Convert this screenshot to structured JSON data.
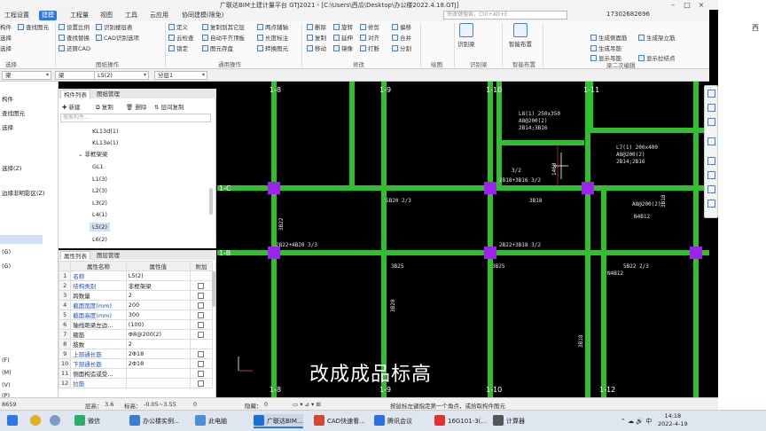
{
  "window": {
    "title": "广联达BIM土建计量平台 GTJ2021 - [C:\\Users\\西瓜\\Desktop\\办公楼2022.4.18.GTJ]",
    "user_phone": "17302682696",
    "search_placeholder": "快速键搜索，Ctrl+Alt+E"
  },
  "menu_tabs": [
    "工程设置",
    "建模",
    "工程量",
    "视图",
    "工具",
    "云应用",
    "协同建模(限免)"
  ],
  "ribbon": {
    "select_group": {
      "items": [
        "构件",
        "选择",
        "选择"
      ],
      "label": "选择"
    },
    "drawing_ops_group": {
      "items": [
        "查找图元",
        "设置比例",
        "识别楼层表",
        "查找替换",
        "CAD识别选项",
        "还原CAD"
      ],
      "label": "图纸操作"
    },
    "general_ops_group": {
      "items": [
        "定义",
        "复制到其它层",
        "两点辅轴",
        "云检查",
        "自动平齐顶板",
        "长度标注",
        "锁定",
        "图元存盘",
        "转换图元"
      ],
      "label": "通用操作"
    },
    "modify_group": {
      "items": [
        "删除",
        "旋转",
        "修剪",
        "偏移",
        "复制",
        "延伸",
        "对齐",
        "合并",
        "移动",
        "镜像",
        "打断",
        "分割"
      ],
      "label": "修改"
    },
    "draw_group": {
      "label": "绘图"
    },
    "identify_beam": {
      "button": "识别梁",
      "label": "识别梁"
    },
    "smart_layout": {
      "button": "智能布置",
      "label": "智能布置"
    },
    "beam_edit_group": {
      "items": [
        "生成侧面筋",
        "生成架立筋",
        "生成吊筋",
        "显示吊筋",
        "显示拉结点"
      ],
      "label": "梁二次编辑"
    }
  },
  "selectors": {
    "type": "梁",
    "subtype": "梁",
    "component": "L5(2)",
    "layer": "分层1"
  },
  "left_nav": {
    "items": [
      "构件",
      "查找图元",
      "选择",
      "选择(Z)",
      "边缘非明影区(Z)",
      "(G)",
      "(G)",
      "(F)",
      "(M)",
      "(V)",
      "(P)",
      "(G)"
    ],
    "first": "构件"
  },
  "component_list": {
    "tabs": [
      "构件列表",
      "图纸管理"
    ],
    "toolbar": [
      "新建",
      "复制",
      "删除",
      "层间复制"
    ],
    "search_placeholder": "搜索构件...",
    "items": [
      "KL13d(1)",
      "KL13e(1)",
      "非框架梁",
      "GL1",
      "L1(3)",
      "L2(3)",
      "L3(2)",
      "L4(1)",
      "L5(2)",
      "L6(2)"
    ],
    "selected": "L5(2)"
  },
  "properties": {
    "tabs": [
      "属性列表",
      "图层管理"
    ],
    "headers": [
      "属性名称",
      "属性值",
      "附加"
    ],
    "rows": [
      {
        "no": "1",
        "name": "名称",
        "value": "L5(2)",
        "check": false
      },
      {
        "no": "2",
        "name": "结构类别",
        "value": "非框架梁",
        "check": true
      },
      {
        "no": "3",
        "name": "跨数量",
        "value": "2",
        "check": true
      },
      {
        "no": "4",
        "name": "截面宽度(mm)",
        "value": "200",
        "check": true
      },
      {
        "no": "5",
        "name": "截面高度(mm)",
        "value": "300",
        "check": true
      },
      {
        "no": "6",
        "name": "轴线距梁左边...",
        "value": "(100)",
        "check": true
      },
      {
        "no": "7",
        "name": "箍筋",
        "value": "Φ8@200(2)",
        "check": true
      },
      {
        "no": "8",
        "name": "肢数",
        "value": "2",
        "check": false
      },
      {
        "no": "9",
        "name": "上部通长筋",
        "value": "2Φ18",
        "check": true
      },
      {
        "no": "10",
        "name": "下部通长筋",
        "value": "2Φ18",
        "check": true
      },
      {
        "no": "11",
        "name": "侧面构造或受...",
        "value": "",
        "check": true
      },
      {
        "no": "12",
        "name": "拉筋",
        "value": "",
        "check": true
      }
    ]
  },
  "canvas": {
    "axis_labels_top": [
      "1-8",
      "1-9",
      "1-10",
      "1-11"
    ],
    "axis_labels_bottom": [
      "1-8",
      "1-9",
      "1-10",
      "1-12"
    ],
    "axis_labels_left": [
      "1-C",
      "1-B"
    ],
    "annotations": [
      "L8(1) 250x350",
      "A8@200(2)",
      "2B14;3B16",
      "L7(1) 200x400",
      "A8@200(2)",
      "2B14;2B16",
      "3B18",
      "A8@200(2)",
      "N4B12",
      "2B18+3B16 3/2",
      "5B20 2/3",
      "3B18",
      "2B22+4B20 3/3",
      "2B22+3B18 3/2",
      "5B22 2/3",
      "N4B12",
      "3B25",
      "3B25",
      "3B22",
      "3B20",
      "3B18",
      "3/2",
      "1460"
    ],
    "subtitle": "改成成品标高",
    "colors": {
      "beam": "#2fbf2f",
      "column": "#a020f0",
      "axis": "#bbbbbb",
      "text": "#e6e6e6",
      "background": "#000000"
    }
  },
  "status_bar": {
    "coord": "8659",
    "floor_height_label": "层高：",
    "floor_height": "3.6",
    "elevation_label": "标高：",
    "elevation": "-0.05~3.55",
    "count": "0",
    "hidden_label": "隐藏：",
    "hidden": "0",
    "hint": "按鼠标左键指定第一个角点，或拾取构件图元"
  },
  "taskbar": {
    "items": [
      "微信",
      "办公楼实例...",
      "此电脑",
      "广联达BIM...",
      "CAD快速看...",
      "腾讯会议",
      "16G101-3(...",
      "计算器"
    ],
    "active": "广联达BIM...",
    "time": "14:18",
    "date": "2022-4-19"
  },
  "right_strip": {
    "text": "西"
  }
}
